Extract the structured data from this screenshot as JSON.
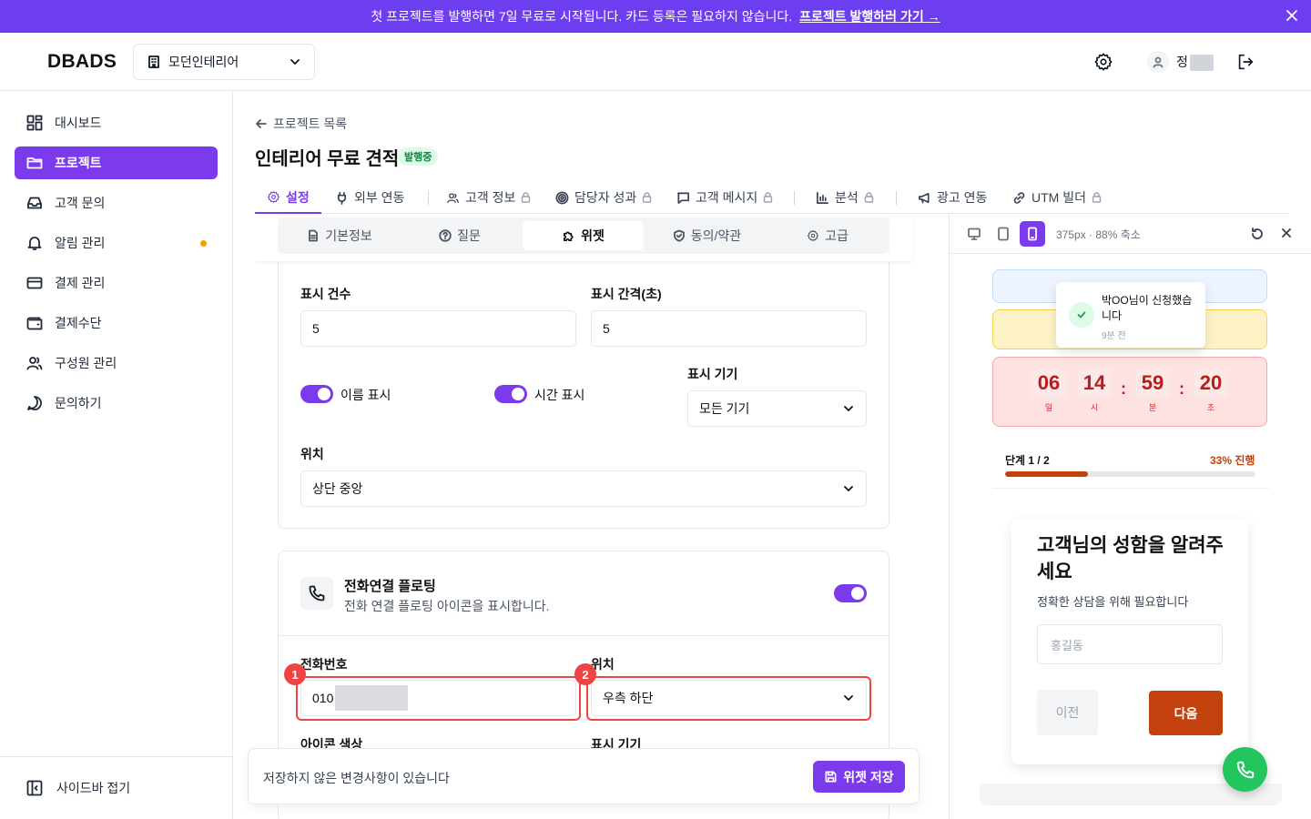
{
  "banner": {
    "message": "첫 프로젝트를 발행하면 7일 무료로 시작됩니다. 카드 등록은 필요하지 않습니다.",
    "link": "프로젝트 발행하러 가기 →"
  },
  "header": {
    "logo": "DBADS",
    "org": "모던인테리어",
    "user_initial": "정"
  },
  "sidebar": {
    "items": [
      {
        "label": "대시보드",
        "icon": "dashboard-icon"
      },
      {
        "label": "프로젝트",
        "icon": "folder-icon",
        "active": true
      },
      {
        "label": "고객 문의",
        "icon": "inbox-icon"
      },
      {
        "label": "알림 관리",
        "icon": "bell-icon",
        "dot": true
      },
      {
        "label": "결제 관리",
        "icon": "credit-card-icon"
      },
      {
        "label": "결제수단",
        "icon": "wallet-icon"
      },
      {
        "label": "구성원 관리",
        "icon": "users-icon"
      },
      {
        "label": "문의하기",
        "icon": "chat-icon"
      }
    ],
    "collapse": "사이드바 접기"
  },
  "page": {
    "back": "프로젝트 목록",
    "title": "인테리어 무료 견적",
    "badge": "발행중"
  },
  "tabs": [
    "설정",
    "외부 연동",
    "고객 정보",
    "담당자 성과",
    "고객 메시지",
    "분석",
    "광고 연동",
    "UTM 빌더"
  ],
  "subtabs": [
    "기본정보",
    "질문",
    "위젯",
    "동의/약관",
    "고급"
  ],
  "form": {
    "count_label": "표시 건수",
    "count_value": "5",
    "interval_label": "표시 간격(초)",
    "interval_value": "5",
    "name_toggle": "이름 표시",
    "time_toggle": "시간 표시",
    "device_label": "표시 기기",
    "device_value": "모든 기기",
    "position_label": "위치",
    "position_value": "상단 중앙"
  },
  "call_card": {
    "title": "전화연결 플로팅",
    "desc": "전화 연결 플로팅 아이콘을 표시합니다.",
    "phone_label": "전화번호",
    "phone_value": "010",
    "position_label": "위치",
    "position_value": "우측 하단",
    "color_label": "아이콘 색상",
    "device_label": "표시 기기",
    "marker1": "1",
    "marker2": "2"
  },
  "savebar": {
    "message": "저장하지 않은 변경사항이 있습니다",
    "button": "위젯 저장"
  },
  "preview": {
    "info": "375px · 88% 축소",
    "toast_text": "박OO님이 신청했습니다",
    "toast_time": "9분 전",
    "countdown": [
      {
        "value": "06",
        "unit": "일"
      },
      {
        "value": "14",
        "unit": "시"
      },
      {
        "value": "59",
        "unit": "분"
      },
      {
        "value": "20",
        "unit": "초"
      }
    ],
    "step": "단계 1 / 2",
    "percent": "33% 진행",
    "progress": 0.33,
    "question": "고객님의 성함을 알려주세요",
    "subtitle": "정확한 상담을 위해 필요합니다",
    "placeholder": "홍길동",
    "prev": "이전",
    "next": "다음"
  },
  "colors": {
    "accent": "#7c3aed",
    "banner": "#6d3df0",
    "cta": "#c2410c",
    "call": "#22c55e",
    "highlight": "#ef4444"
  }
}
